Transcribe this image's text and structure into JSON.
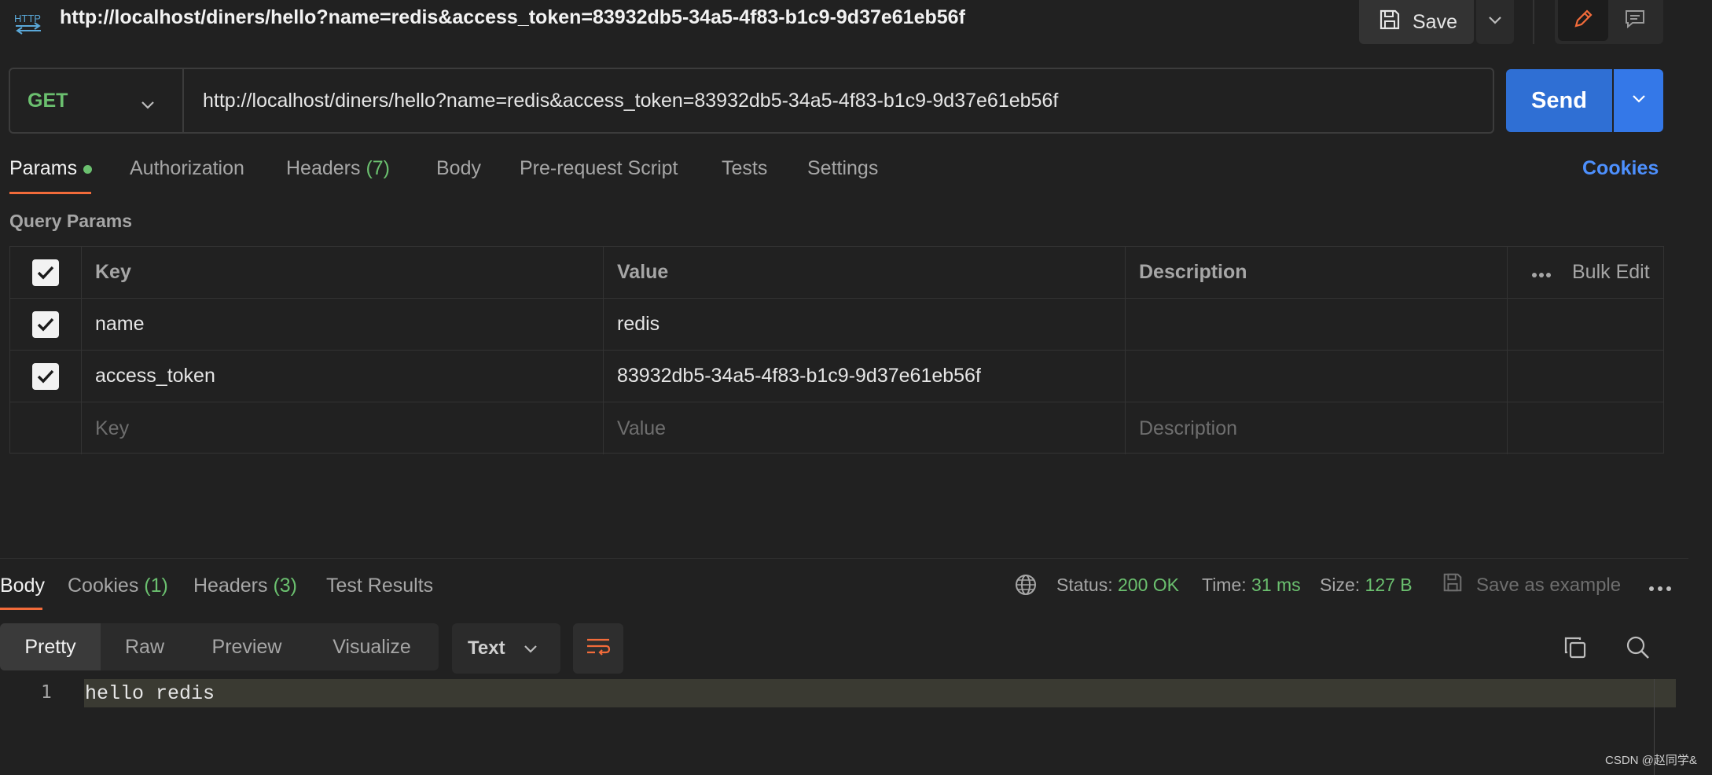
{
  "header": {
    "protocol_badge": "HTTP",
    "title": "http://localhost/diners/hello?name=redis&access_token=83932db5-34a5-4f83-b1c9-9d37e61eb56f",
    "save_label": "Save"
  },
  "request": {
    "method": "GET",
    "url": "http://localhost/diners/hello?name=redis&access_token=83932db5-34a5-4f83-b1c9-9d37e61eb56f",
    "send_label": "Send"
  },
  "request_tabs": {
    "params": "Params",
    "authorization": "Authorization",
    "headers": "Headers",
    "headers_count": "(7)",
    "body": "Body",
    "pre_request": "Pre-request Script",
    "tests": "Tests",
    "settings": "Settings",
    "cookies": "Cookies"
  },
  "query_params": {
    "section_label": "Query Params",
    "columns": {
      "key": "Key",
      "value": "Value",
      "description": "Description",
      "bulk_edit": "Bulk Edit"
    },
    "rows": [
      {
        "key": "name",
        "value": "redis",
        "description": ""
      },
      {
        "key": "access_token",
        "value": "83932db5-34a5-4f83-b1c9-9d37e61eb56f",
        "description": ""
      }
    ],
    "placeholders": {
      "key": "Key",
      "value": "Value",
      "description": "Description"
    }
  },
  "response_tabs": {
    "body": "Body",
    "cookies": "Cookies",
    "cookies_count": "(1)",
    "headers": "Headers",
    "headers_count": "(3)",
    "test_results": "Test Results"
  },
  "response_status": {
    "status_label": "Status:",
    "status_value": "200 OK",
    "time_label": "Time:",
    "time_value": "31 ms",
    "size_label": "Size:",
    "size_value": "127 B",
    "save_example": "Save as example"
  },
  "response_view": {
    "modes": [
      "Pretty",
      "Raw",
      "Preview",
      "Visualize"
    ],
    "format": "Text"
  },
  "response_body": {
    "line_number": "1",
    "content": "hello redis"
  },
  "watermark": "CSDN @赵同学&",
  "colors": {
    "accent_orange": "#f26b3a",
    "send_blue": "#2f6fd4",
    "success_green": "#6bc06f",
    "link_blue": "#4d90fe"
  }
}
